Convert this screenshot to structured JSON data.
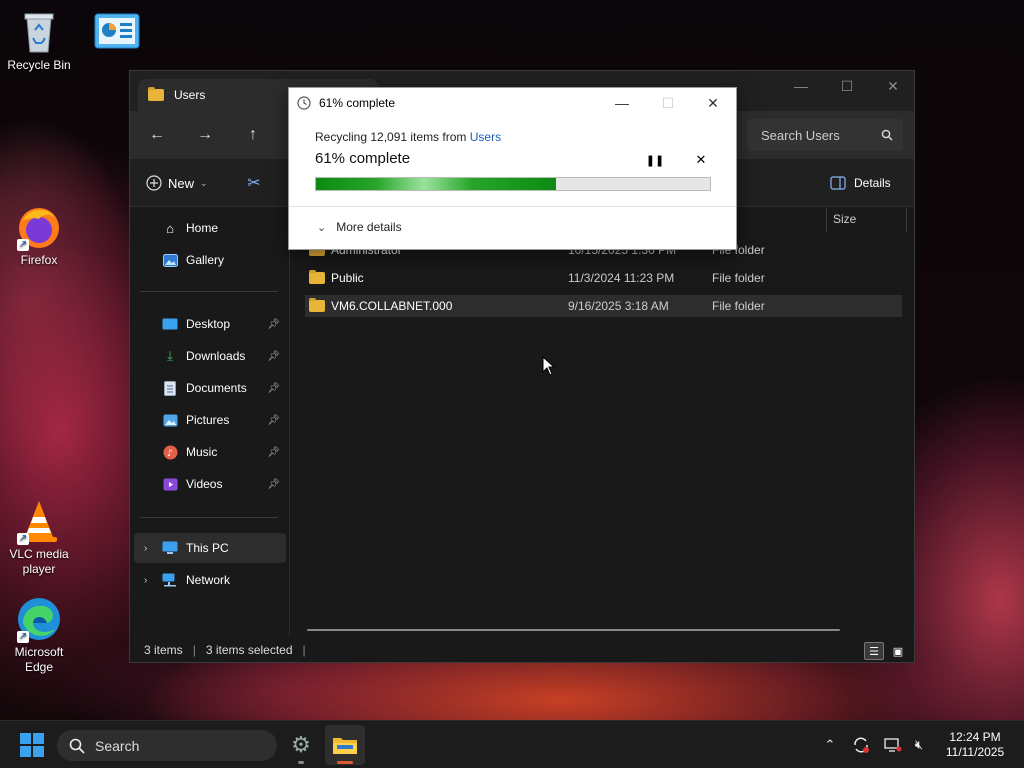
{
  "desktop": {
    "icons": [
      {
        "label": "Recycle Bin"
      },
      {
        "label": ""
      },
      {
        "label": "Firefox"
      },
      {
        "label": "VLC media player"
      },
      {
        "label": "Microsoft Edge"
      }
    ]
  },
  "explorer": {
    "tab_title": "Users",
    "search_placeholder": "Search Users",
    "toolbar": {
      "new_label": "New",
      "details_label": "Details"
    },
    "sidebar": {
      "items": [
        {
          "label": "Home",
          "icon": "home-icon"
        },
        {
          "label": "Gallery",
          "icon": "gallery-icon"
        },
        {
          "label": "Desktop",
          "icon": "desktop-icon",
          "pinned": true
        },
        {
          "label": "Downloads",
          "icon": "download-icon",
          "pinned": true
        },
        {
          "label": "Documents",
          "icon": "document-icon",
          "pinned": true
        },
        {
          "label": "Pictures",
          "icon": "pictures-icon",
          "pinned": true
        },
        {
          "label": "Music",
          "icon": "music-icon",
          "pinned": true
        },
        {
          "label": "Videos",
          "icon": "videos-icon",
          "pinned": true
        },
        {
          "label": "This PC",
          "icon": "computer-icon"
        },
        {
          "label": "Network",
          "icon": "network-icon"
        }
      ]
    },
    "columns": {
      "size": "Size"
    },
    "files": [
      {
        "name": "Administrator",
        "date": "10/15/2025 1:30 PM",
        "type": "File folder"
      },
      {
        "name": "Public",
        "date": "11/3/2024 11:23 PM",
        "type": "File folder"
      },
      {
        "name": "VM6.COLLABNET.000",
        "date": "9/16/2025 3:18 AM",
        "type": "File folder"
      }
    ],
    "status": {
      "item_count": "3 items",
      "selected_count": "3 items selected"
    }
  },
  "dialog": {
    "title": "61% complete",
    "subtitle_prefix": "Recycling 12,091 items from ",
    "subtitle_link": "Users",
    "heading": "61% complete",
    "progress": 0.61,
    "more_details": "More details"
  },
  "taskbar": {
    "search_label": "Search",
    "clock_time": "12:24 PM",
    "clock_date": "11/11/2025"
  },
  "colors": {
    "accent": "#3aa0f0",
    "progress_green": "#1a9a1e",
    "folder_yellow": "#e8b53a",
    "link_blue": "#1a5fb4"
  }
}
